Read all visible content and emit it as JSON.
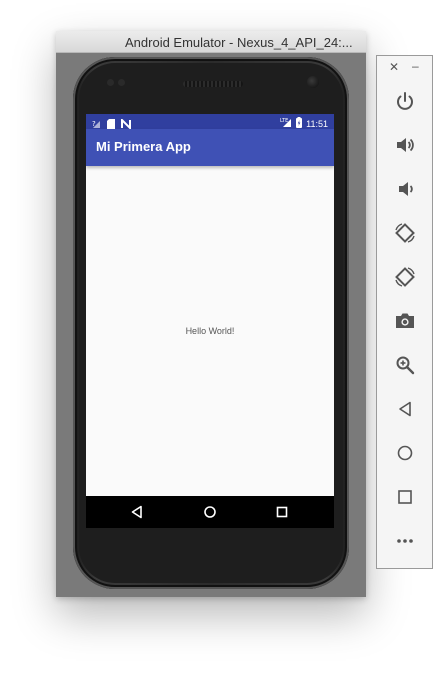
{
  "window": {
    "title": "Android Emulator - Nexus_4_API_24:..."
  },
  "status_bar": {
    "time": "11:51",
    "network_label": "LTE"
  },
  "app": {
    "title": "Mi Primera App",
    "content_text": "Hello World!"
  },
  "toolbar": {
    "buttons": [
      "power-icon",
      "volume-up-icon",
      "volume-down-icon",
      "rotate-left-icon",
      "rotate-right-icon",
      "camera-icon",
      "zoom-icon",
      "back-icon",
      "home-icon",
      "overview-icon",
      "more-icon"
    ]
  },
  "colors": {
    "status_bar": "#303f9f",
    "app_bar": "#3f51b5",
    "screen_bg": "#fafafa",
    "nav_bar": "#000000",
    "toolbar_icon": "#555555"
  }
}
